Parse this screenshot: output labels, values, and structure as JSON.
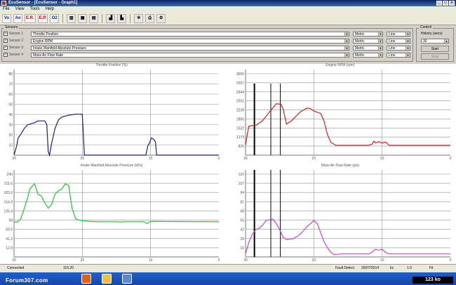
{
  "window": {
    "title": "EcuSensor - [EcuSensor - Graph1]"
  },
  "menu": [
    "File",
    "View",
    "Tools",
    "Help"
  ],
  "toolbar": {
    "buttons": [
      "Vo",
      "Ao",
      "E.R.",
      "E.P.",
      "O2"
    ]
  },
  "sensors_group": {
    "label": "Sensors"
  },
  "sensors": [
    {
      "label": "Sensor 1",
      "parameter": "Throttle Position",
      "unit": "Metric",
      "line": "Line"
    },
    {
      "label": "Sensor 2",
      "parameter": "Engine RPM",
      "unit": "Metric",
      "line": "Line"
    },
    {
      "label": "Sensor 3",
      "parameter": "Intake Manifold Absolute Pressure",
      "unit": "Metric",
      "line": "Line"
    },
    {
      "label": "Sensor 4",
      "parameter": "Mass Air Flow Rate",
      "unit": "Metric",
      "line": "Line"
    }
  ],
  "control": {
    "group_label": "Control",
    "history_label": "History (secs)",
    "history_value": "30",
    "start_label": "Start",
    "stop_label": "Stop"
  },
  "colors": {
    "tp": "#1a1f7a",
    "rpm": "#d42020",
    "map": "#22c83a",
    "maf": "#d640d6",
    "cursor": "#000000"
  },
  "charts": {
    "tp": {
      "title": "Throttle Position (%)"
    },
    "rpm": {
      "title": "Engine RPM (rpm)"
    },
    "map": {
      "title": "Intake Manifold Absolute Pressure (kPa)"
    },
    "maf": {
      "title": "Mass Air Flow Rate (g/s)"
    }
  },
  "chart_data": [
    {
      "type": "line",
      "title": "Throttle Position (%)",
      "color": "#1a1f7a",
      "yticks": [
        "80",
        "70",
        "60",
        "50",
        "40",
        "30",
        "20",
        "10"
      ],
      "xticks": [
        "30",
        "20",
        "10",
        "0"
      ],
      "ylim": [
        0,
        90
      ],
      "xlim": [
        30,
        0
      ],
      "x": [
        30,
        29.6,
        29.4,
        29,
        28.5,
        28,
        27,
        26.5,
        25.5,
        25.2,
        25,
        24.8,
        24.5,
        24,
        23.5,
        23,
        22,
        21,
        20,
        19.7,
        19.5,
        19.3,
        19,
        18,
        12,
        11.5,
        11,
        10.7,
        10.4,
        10.2,
        10,
        9.9,
        9.6,
        9.3,
        9.1,
        9,
        0
      ],
      "y": [
        0,
        10,
        18,
        22,
        28,
        32,
        34,
        36,
        36,
        32,
        4,
        0,
        12,
        28,
        37,
        40,
        42,
        43,
        43,
        0,
        0,
        0,
        0,
        0,
        0,
        0,
        0,
        0,
        10,
        12,
        16,
        18,
        17,
        14,
        0,
        0,
        0
      ]
    },
    {
      "type": "line",
      "title": "Engine RPM (rpm)",
      "color": "#d42020",
      "yticks": [
        "3650",
        "3297",
        "2944",
        "2591",
        "2238",
        "1885",
        "1532",
        "1179",
        "826"
      ],
      "xticks": [
        "30",
        "20",
        "10",
        "0"
      ],
      "ylim": [
        826,
        3650
      ],
      "xlim": [
        30,
        0
      ],
      "x": [
        30,
        29.7,
        29.5,
        29,
        28.5,
        27.5,
        26.5,
        25.5,
        24.8,
        24.5,
        24,
        23.3,
        22,
        21,
        20.5,
        20,
        19,
        18.5,
        18,
        17.5,
        16.8,
        16.5,
        16,
        15,
        14,
        12,
        11.5,
        11.2,
        11,
        10.8,
        10.5,
        10,
        9.5,
        9,
        8,
        0
      ],
      "y": [
        1160,
        1560,
        1780,
        1800,
        1810,
        1960,
        2250,
        2520,
        2500,
        2350,
        1850,
        1950,
        2250,
        2380,
        2360,
        2280,
        2200,
        1950,
        1500,
        1250,
        1150,
        1150,
        1150,
        1150,
        1150,
        1150,
        1180,
        1290,
        1230,
        1240,
        1270,
        1220,
        1260,
        1150,
        1150,
        1150
      ]
    },
    {
      "type": "line",
      "title": "Intake Manifold Absolute Pressure (kPa)",
      "color": "#22c83a",
      "yticks": [
        "240",
        "211.6",
        "183.2",
        "154.8",
        "126.4",
        "98",
        "69.6",
        "41.2",
        "12.8"
      ],
      "xticks": [
        "30",
        "20",
        "10",
        "0"
      ],
      "ylim": [
        0,
        250
      ],
      "xlim": [
        30,
        0
      ],
      "x": [
        30,
        29.5,
        29,
        28.5,
        28,
        27.7,
        27,
        26.5,
        26,
        25.5,
        25,
        24.5,
        24,
        23.5,
        23,
        22.5,
        22,
        21.5,
        21,
        20.5,
        20,
        19.5,
        19,
        18,
        15,
        14.5,
        14,
        11,
        10.5,
        10,
        0
      ],
      "y": [
        100,
        100,
        110,
        140,
        170,
        195,
        210,
        180,
        175,
        155,
        140,
        150,
        180,
        190,
        195,
        210,
        205,
        140,
        110,
        106,
        104,
        103,
        102,
        101,
        101,
        100,
        101,
        101,
        96,
        102,
        101
      ]
    },
    {
      "type": "line",
      "title": "Mass Air Flow Rate (g/s)",
      "color": "#d640d6",
      "yticks": [
        "120",
        "107",
        "94",
        "81",
        "68",
        "55",
        "42",
        "29",
        "16"
      ],
      "xticks": [
        "30",
        "20",
        "10",
        "0"
      ],
      "ylim": [
        10,
        125
      ],
      "xlim": [
        30,
        0
      ],
      "x": [
        30,
        29.8,
        29.5,
        29,
        28.5,
        28,
        27.5,
        27,
        26,
        25.5,
        25,
        24.5,
        24,
        23,
        22,
        21,
        20.5,
        20,
        19.5,
        19,
        18.5,
        18,
        17.5,
        17,
        16,
        14,
        12,
        11.5,
        11,
        10.5,
        10,
        9.5,
        9,
        8,
        0
      ],
      "y": [
        14,
        20,
        30,
        40,
        46,
        48,
        52,
        58,
        60,
        54,
        46,
        36,
        33,
        34,
        40,
        50,
        54,
        58,
        54,
        42,
        30,
        22,
        16,
        13,
        14,
        14,
        14,
        16,
        20,
        19,
        20,
        16,
        14,
        14,
        14
      ]
    }
  ],
  "status": {
    "left": "Connected",
    "speed": "115.20",
    "fault": "Fault Detect",
    "date": "20/07/2014",
    "ks": "ks",
    "kk": "1.0",
    "fit": "Fit"
  },
  "watermark": "Forum307.com",
  "size_badge": "123 ko"
}
